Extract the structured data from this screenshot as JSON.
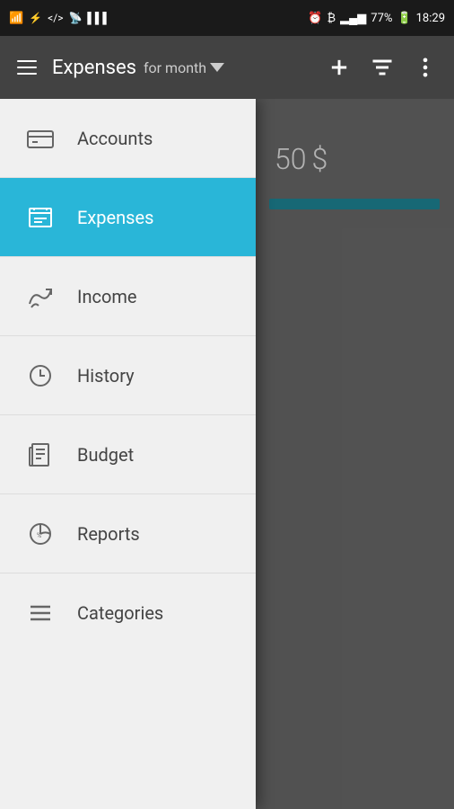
{
  "statusBar": {
    "time": "18:29",
    "battery": "77%",
    "icons": [
      "usb",
      "dev",
      "alarm",
      "currency",
      "signal",
      "signal2"
    ]
  },
  "appBar": {
    "title": "Expenses",
    "subtitle": "for month",
    "addLabel": "+",
    "filterLabel": "≡",
    "moreLabel": "⋮"
  },
  "background": {
    "amount": "50",
    "currency": "$"
  },
  "nav": {
    "items": [
      {
        "id": "accounts",
        "label": "Accounts",
        "active": false
      },
      {
        "id": "expenses",
        "label": "Expenses",
        "active": true
      },
      {
        "id": "income",
        "label": "Income",
        "active": false
      },
      {
        "id": "history",
        "label": "History",
        "active": false
      },
      {
        "id": "budget",
        "label": "Budget",
        "active": false
      },
      {
        "id": "reports",
        "label": "Reports",
        "active": false
      },
      {
        "id": "categories",
        "label": "Categories",
        "active": false
      }
    ]
  }
}
